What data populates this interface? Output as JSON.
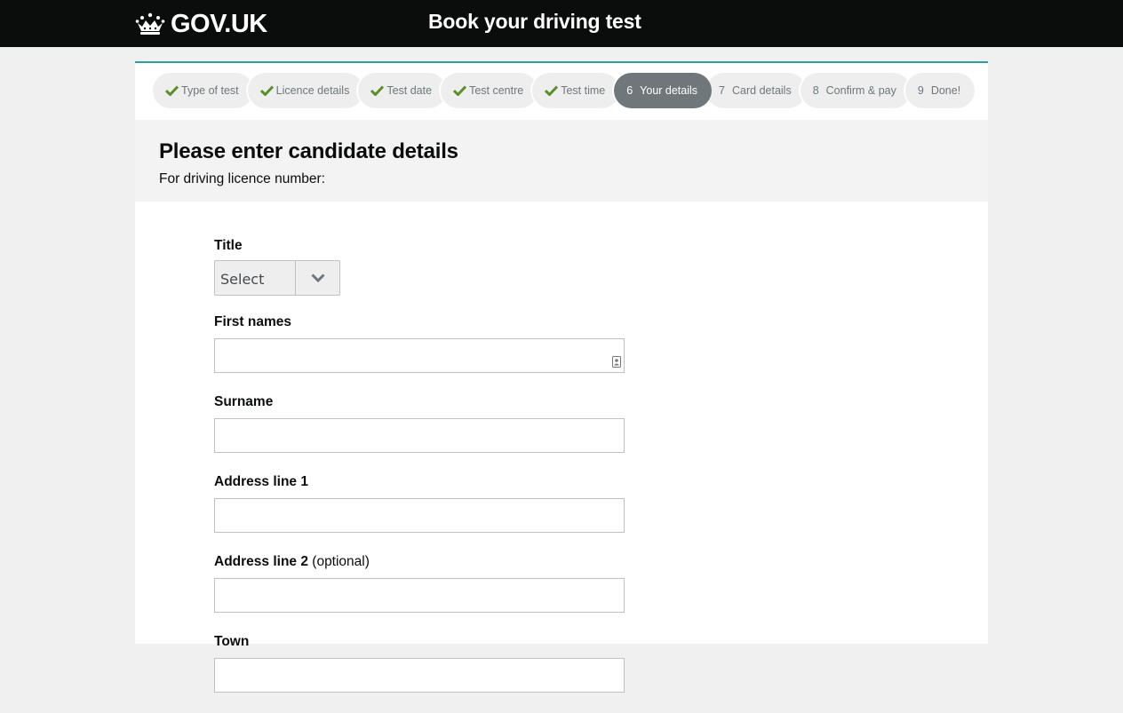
{
  "header": {
    "logo_text": "GOV.UK",
    "service_name": "Book your driving test"
  },
  "steps": [
    {
      "label": "Type of test",
      "status": "done"
    },
    {
      "label": "Licence details",
      "status": "done"
    },
    {
      "label": "Test date",
      "status": "done"
    },
    {
      "label": "Test centre",
      "status": "done"
    },
    {
      "label": "Test time",
      "status": "done"
    },
    {
      "number": "6",
      "label": "Your details",
      "status": "current"
    },
    {
      "number": "7",
      "label": "Card details",
      "status": "upcoming"
    },
    {
      "number": "8",
      "label": "Confirm & pay",
      "status": "upcoming"
    },
    {
      "number": "9",
      "label": "Done!",
      "status": "upcoming"
    }
  ],
  "page": {
    "title": "Please enter candidate details",
    "subtitle": "For driving licence number:"
  },
  "form": {
    "title_label": "Title",
    "title_value": "Select",
    "first_names_label": "First names",
    "surname_label": "Surname",
    "address1_label": "Address line 1",
    "address2_label": "Address line 2",
    "address2_optional": "(optional)",
    "town_label": "Town"
  },
  "colors": {
    "header_bg": "#0b0c0c",
    "accent_turquoise": "#28a197",
    "tick_green": "#5a8f29",
    "current_step_bg": "#6f777b"
  }
}
